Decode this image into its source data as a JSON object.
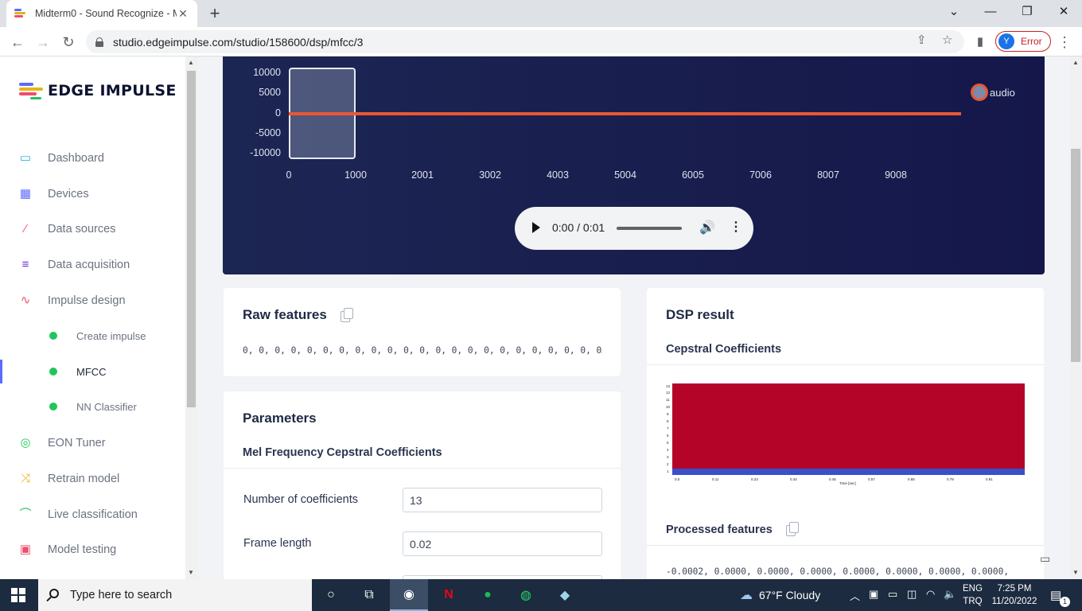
{
  "browser": {
    "tab_title": "Midterm0 - Sound Recognize - M",
    "url": "studio.edgeimpulse.com/studio/158600/dsp/mfcc/3",
    "profile_initial": "Y",
    "profile_status": "Error"
  },
  "sidebar": {
    "logo": "EDGE IMPULSE",
    "items": [
      {
        "label": "Dashboard",
        "icon": "monitor-icon",
        "color": "#27b3d9"
      },
      {
        "label": "Devices",
        "icon": "chip-icon",
        "color": "#5b6bff"
      },
      {
        "label": "Data sources",
        "icon": "wand-icon",
        "color": "#ef4d6b"
      },
      {
        "label": "Data acquisition",
        "icon": "database-icon",
        "color": "#6a2bd9"
      },
      {
        "label": "Impulse design",
        "icon": "pulse-icon",
        "color": "#ef4d6b"
      },
      {
        "label": "EON Tuner",
        "icon": "compass-icon",
        "color": "#21c55d"
      },
      {
        "label": "Retrain model",
        "icon": "shuffle-icon",
        "color": "#e7b416"
      },
      {
        "label": "Live classification",
        "icon": "signal-icon",
        "color": "#21c55d"
      },
      {
        "label": "Model testing",
        "icon": "clipboard-icon",
        "color": "#ef4d6b"
      }
    ],
    "sub_items": [
      {
        "label": "Create impulse"
      },
      {
        "label": "MFCC"
      },
      {
        "label": "NN Classifier"
      }
    ]
  },
  "waveform": {
    "y_ticks": [
      "10000",
      "5000",
      "0",
      "-5000",
      "-10000"
    ],
    "x_ticks": [
      "0",
      "1000",
      "2001",
      "3002",
      "4003",
      "5004",
      "6005",
      "7006",
      "8007",
      "9008"
    ],
    "legend": "audio",
    "series_color": "#ea5734",
    "player_time": "0:00 / 0:01"
  },
  "raw_features": {
    "title": "Raw features",
    "values": "0, 0, 0, 0, 0, 0, 0, 0, 0, 0, 0, 0, 0, 0, 0, 0, 0, 0, 0, 0, 0, 0, 0…"
  },
  "parameters": {
    "title": "Parameters",
    "subtitle": "Mel Frequency Cepstral Coefficients",
    "fields": [
      {
        "label": "Number of coefficients",
        "value": "13"
      },
      {
        "label": "Frame length",
        "value": "0.02"
      }
    ]
  },
  "dsp_result": {
    "title": "DSP result",
    "subtitle": "Cepstral Coefficients",
    "heatmap_colors": {
      "high": "#b40529",
      "low": "#3b4fc8"
    },
    "y_ticks": [
      "13",
      "12",
      "11",
      "10",
      "9",
      "8",
      "7",
      "6",
      "5",
      "4",
      "3",
      "2",
      "1"
    ],
    "x_ticks": [
      "0.0",
      "0.11",
      "0.23",
      "0.34",
      "0.45",
      "0.57",
      "0.68",
      "0.79",
      "0.91"
    ],
    "xlabel": "Time [sec]",
    "processed_title": "Processed features",
    "processed_values": "-0.0002, 0.0000, 0.0000, 0.0000, 0.0000, 0.0000, 0.0000, 0.0000, 0.…"
  },
  "taskbar": {
    "search_placeholder": "Type here to search",
    "weather": "67°F  Cloudy",
    "lang_top": "ENG",
    "lang_bottom": "TRQ",
    "time": "7:25 PM",
    "date": "11/20/2022",
    "notification_count": "1"
  }
}
